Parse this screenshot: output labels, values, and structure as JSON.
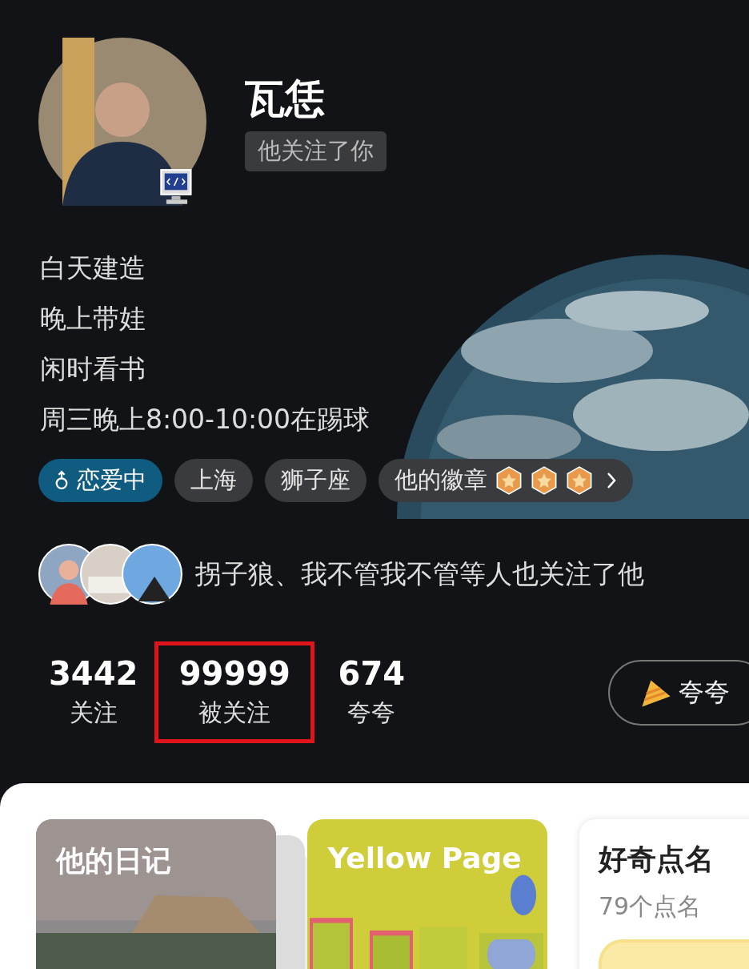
{
  "profile": {
    "name": "瓦恁",
    "follow_tag": "他关注了你"
  },
  "bio": [
    "白天建造",
    "晚上带娃",
    "闲时看书",
    "周三晚上8:00-10:00在踢球"
  ],
  "tags": [
    {
      "kind": "status",
      "label": "恋爱中"
    },
    {
      "kind": "plain",
      "label": "上海"
    },
    {
      "kind": "plain",
      "label": "狮子座"
    },
    {
      "kind": "badges",
      "label": "他的徽章"
    }
  ],
  "mutual_followers": {
    "text": "拐子狼、我不管我不管等人也关注了他"
  },
  "stats": [
    {
      "value": "3442",
      "label": "关注",
      "highlighted": false
    },
    {
      "value": "99999",
      "label": "被关注",
      "highlighted": true
    },
    {
      "value": "674",
      "label": "夸夸",
      "highlighted": false
    }
  ],
  "praise_button": {
    "label": "夸夸"
  },
  "cards": [
    {
      "title": "他的日记"
    },
    {
      "title": "Yellow Page"
    },
    {
      "kind": "text",
      "title": "好奇点名",
      "subtitle": "79个点名"
    }
  ]
}
